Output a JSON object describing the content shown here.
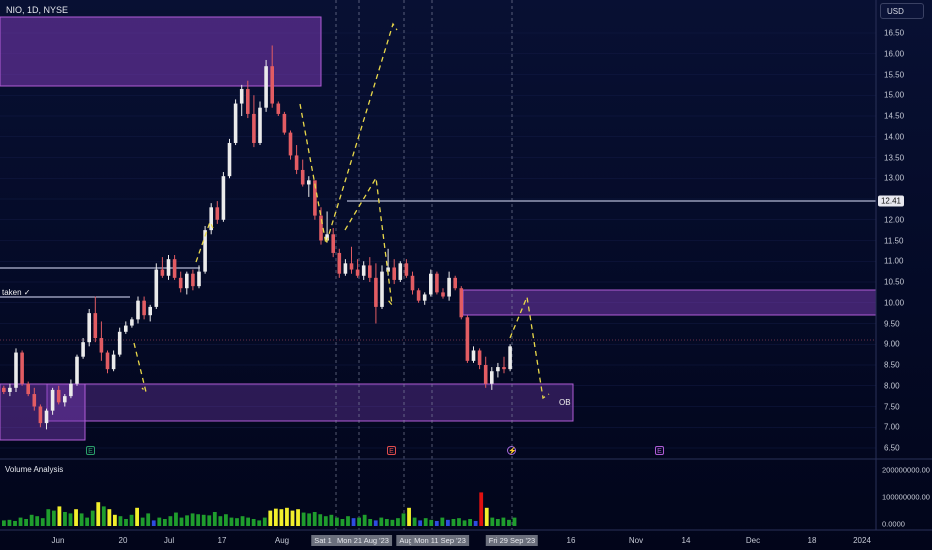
{
  "header": {
    "symbol_line": "NIO, 1D, NYSE",
    "currency_button": "USD"
  },
  "price_axis": {
    "ticks": [
      "16.50",
      "16.00",
      "15.50",
      "15.00",
      "14.50",
      "14.00",
      "13.50",
      "13.00",
      "12.50",
      "12.00",
      "11.50",
      "11.00",
      "10.50",
      "10.00",
      "9.50",
      "9.00",
      "8.50",
      "8.00",
      "7.50",
      "7.00",
      "6.50"
    ],
    "current_price": "12.41"
  },
  "volume_pane": {
    "label": "Volume Analysis",
    "ticks": [
      "200000000.00",
      "100000000.00",
      "0.0000"
    ]
  },
  "time_axis": {
    "ticks": [
      "Jun",
      "20",
      "Jul",
      "17",
      "Aug",
      "Sep",
      "18",
      "16",
      "Nov",
      "14",
      "Dec",
      "18",
      "2024"
    ],
    "crosshair_labels": [
      "Sat 1",
      "Mon 21 Aug '23",
      "Aug",
      "Mon 11 Sep '23",
      "Fri 29 Sep '23"
    ]
  },
  "annotations": {
    "taken_label": "taken ✓",
    "ob_label": "OB"
  },
  "event_markers": [
    "E",
    "E",
    "⚡",
    "E"
  ],
  "colors": {
    "bullish": "#ebebeb",
    "bearish": "#e25c63",
    "zone_fill": "#7b3bb5",
    "zone_border": "#b05cd6",
    "dashed_path": "#e9d84a",
    "vol_green": "#1f9d2d",
    "vol_yellow": "#f2ef2c",
    "vol_blue": "#2e4ce0",
    "vol_red": "#e01010"
  },
  "chart_data": {
    "type": "candlestick",
    "symbol": "NIO",
    "interval": "1D",
    "exchange": "NYSE",
    "ylim": [
      6.2,
      16.9
    ],
    "price_lines": [
      12.41
    ],
    "candles": [
      {
        "o": 7.95,
        "h": 8.0,
        "l": 7.8,
        "c": 7.85
      },
      {
        "o": 7.85,
        "h": 8.05,
        "l": 7.75,
        "c": 7.95
      },
      {
        "o": 7.95,
        "h": 8.9,
        "l": 7.85,
        "c": 8.8
      },
      {
        "o": 8.8,
        "h": 8.85,
        "l": 8.0,
        "c": 8.05
      },
      {
        "o": 8.05,
        "h": 8.1,
        "l": 7.75,
        "c": 7.8
      },
      {
        "o": 7.8,
        "h": 7.95,
        "l": 7.4,
        "c": 7.5
      },
      {
        "o": 7.5,
        "h": 7.55,
        "l": 7.0,
        "c": 7.1
      },
      {
        "o": 7.1,
        "h": 7.45,
        "l": 6.95,
        "c": 7.4
      },
      {
        "o": 7.4,
        "h": 7.95,
        "l": 7.3,
        "c": 7.9
      },
      {
        "o": 7.9,
        "h": 8.0,
        "l": 7.55,
        "c": 7.6
      },
      {
        "o": 7.6,
        "h": 7.8,
        "l": 7.5,
        "c": 7.75
      },
      {
        "o": 7.75,
        "h": 8.15,
        "l": 7.7,
        "c": 8.05
      },
      {
        "o": 8.05,
        "h": 8.75,
        "l": 8.0,
        "c": 8.7
      },
      {
        "o": 8.7,
        "h": 9.15,
        "l": 8.65,
        "c": 9.05
      },
      {
        "o": 9.05,
        "h": 9.85,
        "l": 8.95,
        "c": 9.75
      },
      {
        "o": 9.75,
        "h": 10.15,
        "l": 9.05,
        "c": 9.15
      },
      {
        "o": 9.15,
        "h": 9.55,
        "l": 8.6,
        "c": 8.8
      },
      {
        "o": 8.8,
        "h": 8.85,
        "l": 8.3,
        "c": 8.4
      },
      {
        "o": 8.4,
        "h": 8.85,
        "l": 8.35,
        "c": 8.75
      },
      {
        "o": 8.75,
        "h": 9.4,
        "l": 8.7,
        "c": 9.3
      },
      {
        "o": 9.3,
        "h": 9.55,
        "l": 9.25,
        "c": 9.45
      },
      {
        "o": 9.45,
        "h": 9.65,
        "l": 9.4,
        "c": 9.6
      },
      {
        "o": 9.6,
        "h": 10.15,
        "l": 9.5,
        "c": 10.05
      },
      {
        "o": 10.05,
        "h": 10.15,
        "l": 9.6,
        "c": 9.7
      },
      {
        "o": 9.7,
        "h": 9.95,
        "l": 9.55,
        "c": 9.9
      },
      {
        "o": 9.9,
        "h": 10.95,
        "l": 9.85,
        "c": 10.8
      },
      {
        "o": 10.8,
        "h": 11.1,
        "l": 10.6,
        "c": 10.65
      },
      {
        "o": 10.65,
        "h": 11.15,
        "l": 10.55,
        "c": 11.05
      },
      {
        "o": 11.05,
        "h": 11.15,
        "l": 10.55,
        "c": 10.6
      },
      {
        "o": 10.6,
        "h": 10.75,
        "l": 10.25,
        "c": 10.35
      },
      {
        "o": 10.35,
        "h": 10.75,
        "l": 10.2,
        "c": 10.7
      },
      {
        "o": 10.7,
        "h": 10.8,
        "l": 10.3,
        "c": 10.4
      },
      {
        "o": 10.4,
        "h": 10.9,
        "l": 10.35,
        "c": 10.75
      },
      {
        "o": 10.75,
        "h": 11.85,
        "l": 10.7,
        "c": 11.75
      },
      {
        "o": 11.75,
        "h": 12.4,
        "l": 11.65,
        "c": 12.3
      },
      {
        "o": 12.3,
        "h": 12.45,
        "l": 11.9,
        "c": 12.0
      },
      {
        "o": 12.0,
        "h": 13.15,
        "l": 11.95,
        "c": 13.05
      },
      {
        "o": 13.05,
        "h": 13.95,
        "l": 13.0,
        "c": 13.85
      },
      {
        "o": 13.85,
        "h": 14.9,
        "l": 13.8,
        "c": 14.8
      },
      {
        "o": 14.8,
        "h": 15.25,
        "l": 14.5,
        "c": 15.15
      },
      {
        "o": 15.15,
        "h": 15.35,
        "l": 14.45,
        "c": 14.55
      },
      {
        "o": 14.55,
        "h": 15.0,
        "l": 13.75,
        "c": 13.85
      },
      {
        "o": 13.85,
        "h": 14.85,
        "l": 13.8,
        "c": 14.7
      },
      {
        "o": 14.7,
        "h": 15.85,
        "l": 14.6,
        "c": 15.7
      },
      {
        "o": 15.7,
        "h": 16.2,
        "l": 14.7,
        "c": 14.8
      },
      {
        "o": 14.8,
        "h": 14.85,
        "l": 14.5,
        "c": 14.55
      },
      {
        "o": 14.55,
        "h": 14.6,
        "l": 14.05,
        "c": 14.1
      },
      {
        "o": 14.1,
        "h": 14.15,
        "l": 13.45,
        "c": 13.55
      },
      {
        "o": 13.55,
        "h": 13.8,
        "l": 13.1,
        "c": 13.2
      },
      {
        "o": 13.2,
        "h": 13.45,
        "l": 12.8,
        "c": 12.85
      },
      {
        "o": 12.85,
        "h": 13.05,
        "l": 12.55,
        "c": 12.95
      },
      {
        "o": 12.95,
        "h": 12.6,
        "l": 12.0,
        "c": 12.1
      },
      {
        "o": 12.1,
        "h": 12.3,
        "l": 11.4,
        "c": 11.5
      },
      {
        "o": 11.5,
        "h": 12.2,
        "l": 11.45,
        "c": 11.65
      },
      {
        "o": 11.65,
        "h": 11.8,
        "l": 11.1,
        "c": 11.2
      },
      {
        "o": 11.2,
        "h": 11.3,
        "l": 10.6,
        "c": 10.7
      },
      {
        "o": 10.7,
        "h": 11.05,
        "l": 10.65,
        "c": 10.95
      },
      {
        "o": 10.95,
        "h": 11.35,
        "l": 10.7,
        "c": 10.8
      },
      {
        "o": 10.8,
        "h": 11.05,
        "l": 10.6,
        "c": 10.65
      },
      {
        "o": 10.65,
        "h": 11.0,
        "l": 10.55,
        "c": 10.9
      },
      {
        "o": 10.9,
        "h": 11.1,
        "l": 10.5,
        "c": 10.6
      },
      {
        "o": 10.6,
        "h": 10.95,
        "l": 9.5,
        "c": 9.9
      },
      {
        "o": 9.9,
        "h": 10.9,
        "l": 9.85,
        "c": 10.75
      },
      {
        "o": 10.75,
        "h": 11.3,
        "l": 10.65,
        "c": 10.85
      },
      {
        "o": 10.85,
        "h": 11.05,
        "l": 10.45,
        "c": 10.55
      },
      {
        "o": 10.55,
        "h": 11.0,
        "l": 10.5,
        "c": 10.95
      },
      {
        "o": 10.95,
        "h": 11.05,
        "l": 10.6,
        "c": 10.65
      },
      {
        "o": 10.65,
        "h": 10.75,
        "l": 10.2,
        "c": 10.3
      },
      {
        "o": 10.3,
        "h": 10.35,
        "l": 10.0,
        "c": 10.05
      },
      {
        "o": 10.05,
        "h": 10.25,
        "l": 9.95,
        "c": 10.2
      },
      {
        "o": 10.2,
        "h": 10.8,
        "l": 10.15,
        "c": 10.7
      },
      {
        "o": 10.7,
        "h": 10.75,
        "l": 10.2,
        "c": 10.25
      },
      {
        "o": 10.25,
        "h": 10.35,
        "l": 10.1,
        "c": 10.15
      },
      {
        "o": 10.15,
        "h": 10.75,
        "l": 10.05,
        "c": 10.6
      },
      {
        "o": 10.6,
        "h": 10.65,
        "l": 10.3,
        "c": 10.35
      },
      {
        "o": 10.35,
        "h": 10.4,
        "l": 9.6,
        "c": 9.65
      },
      {
        "o": 9.65,
        "h": 9.7,
        "l": 8.55,
        "c": 8.6
      },
      {
        "o": 8.6,
        "h": 8.95,
        "l": 8.55,
        "c": 8.85
      },
      {
        "o": 8.85,
        "h": 8.9,
        "l": 8.4,
        "c": 8.5
      },
      {
        "o": 8.5,
        "h": 8.7,
        "l": 7.95,
        "c": 8.05
      },
      {
        "o": 8.05,
        "h": 8.45,
        "l": 7.9,
        "c": 8.35
      },
      {
        "o": 8.35,
        "h": 8.55,
        "l": 8.2,
        "c": 8.45
      },
      {
        "o": 8.45,
        "h": 8.7,
        "l": 8.3,
        "c": 8.4
      },
      {
        "o": 8.4,
        "h": 9.0,
        "l": 8.35,
        "c": 8.95
      }
    ],
    "volume": [
      {
        "v": 20,
        "c": "green"
      },
      {
        "v": 22,
        "c": "green"
      },
      {
        "v": 18,
        "c": "green"
      },
      {
        "v": 30,
        "c": "green"
      },
      {
        "v": 25,
        "c": "green"
      },
      {
        "v": 40,
        "c": "green"
      },
      {
        "v": 35,
        "c": "green"
      },
      {
        "v": 28,
        "c": "green"
      },
      {
        "v": 60,
        "c": "green"
      },
      {
        "v": 55,
        "c": "green"
      },
      {
        "v": 70,
        "c": "yellow"
      },
      {
        "v": 50,
        "c": "green"
      },
      {
        "v": 45,
        "c": "green"
      },
      {
        "v": 60,
        "c": "yellow"
      },
      {
        "v": 45,
        "c": "green"
      },
      {
        "v": 30,
        "c": "green"
      },
      {
        "v": 55,
        "c": "green"
      },
      {
        "v": 85,
        "c": "yellow"
      },
      {
        "v": 70,
        "c": "green"
      },
      {
        "v": 60,
        "c": "yellow"
      },
      {
        "v": 40,
        "c": "yellow"
      },
      {
        "v": 35,
        "c": "green"
      },
      {
        "v": 25,
        "c": "green"
      },
      {
        "v": 40,
        "c": "green"
      },
      {
        "v": 65,
        "c": "yellow"
      },
      {
        "v": 30,
        "c": "green"
      },
      {
        "v": 45,
        "c": "green"
      },
      {
        "v": 20,
        "c": "blue"
      },
      {
        "v": 30,
        "c": "green"
      },
      {
        "v": 25,
        "c": "green"
      },
      {
        "v": 35,
        "c": "green"
      },
      {
        "v": 48,
        "c": "green"
      },
      {
        "v": 30,
        "c": "green"
      },
      {
        "v": 38,
        "c": "green"
      },
      {
        "v": 45,
        "c": "green"
      },
      {
        "v": 42,
        "c": "green"
      },
      {
        "v": 40,
        "c": "green"
      },
      {
        "v": 38,
        "c": "green"
      },
      {
        "v": 50,
        "c": "green"
      },
      {
        "v": 35,
        "c": "green"
      },
      {
        "v": 42,
        "c": "green"
      },
      {
        "v": 30,
        "c": "green"
      },
      {
        "v": 28,
        "c": "green"
      },
      {
        "v": 35,
        "c": "green"
      },
      {
        "v": 30,
        "c": "green"
      },
      {
        "v": 25,
        "c": "green"
      },
      {
        "v": 20,
        "c": "green"
      },
      {
        "v": 30,
        "c": "green"
      },
      {
        "v": 55,
        "c": "yellow"
      },
      {
        "v": 62,
        "c": "yellow"
      },
      {
        "v": 60,
        "c": "yellow"
      },
      {
        "v": 65,
        "c": "yellow"
      },
      {
        "v": 55,
        "c": "yellow"
      },
      {
        "v": 60,
        "c": "yellow"
      },
      {
        "v": 48,
        "c": "green"
      },
      {
        "v": 45,
        "c": "green"
      },
      {
        "v": 50,
        "c": "green"
      },
      {
        "v": 42,
        "c": "green"
      },
      {
        "v": 35,
        "c": "green"
      },
      {
        "v": 40,
        "c": "green"
      },
      {
        "v": 30,
        "c": "green"
      },
      {
        "v": 25,
        "c": "green"
      },
      {
        "v": 35,
        "c": "green"
      },
      {
        "v": 28,
        "c": "blue"
      },
      {
        "v": 30,
        "c": "green"
      },
      {
        "v": 40,
        "c": "green"
      },
      {
        "v": 25,
        "c": "green"
      },
      {
        "v": 20,
        "c": "blue"
      },
      {
        "v": 30,
        "c": "green"
      },
      {
        "v": 25,
        "c": "green"
      },
      {
        "v": 22,
        "c": "green"
      },
      {
        "v": 28,
        "c": "green"
      },
      {
        "v": 45,
        "c": "green"
      },
      {
        "v": 65,
        "c": "yellow"
      },
      {
        "v": 30,
        "c": "green"
      },
      {
        "v": 20,
        "c": "blue"
      },
      {
        "v": 28,
        "c": "green"
      },
      {
        "v": 22,
        "c": "green"
      },
      {
        "v": 18,
        "c": "blue"
      },
      {
        "v": 30,
        "c": "green"
      },
      {
        "v": 22,
        "c": "blue"
      },
      {
        "v": 25,
        "c": "green"
      },
      {
        "v": 28,
        "c": "green"
      },
      {
        "v": 20,
        "c": "green"
      },
      {
        "v": 25,
        "c": "green"
      },
      {
        "v": 18,
        "c": "blue"
      },
      {
        "v": 120,
        "c": "red"
      },
      {
        "v": 65,
        "c": "yellow"
      },
      {
        "v": 30,
        "c": "green"
      },
      {
        "v": 25,
        "c": "green"
      },
      {
        "v": 30,
        "c": "green"
      },
      {
        "v": 22,
        "c": "green"
      },
      {
        "v": 30,
        "c": "green"
      }
    ]
  }
}
